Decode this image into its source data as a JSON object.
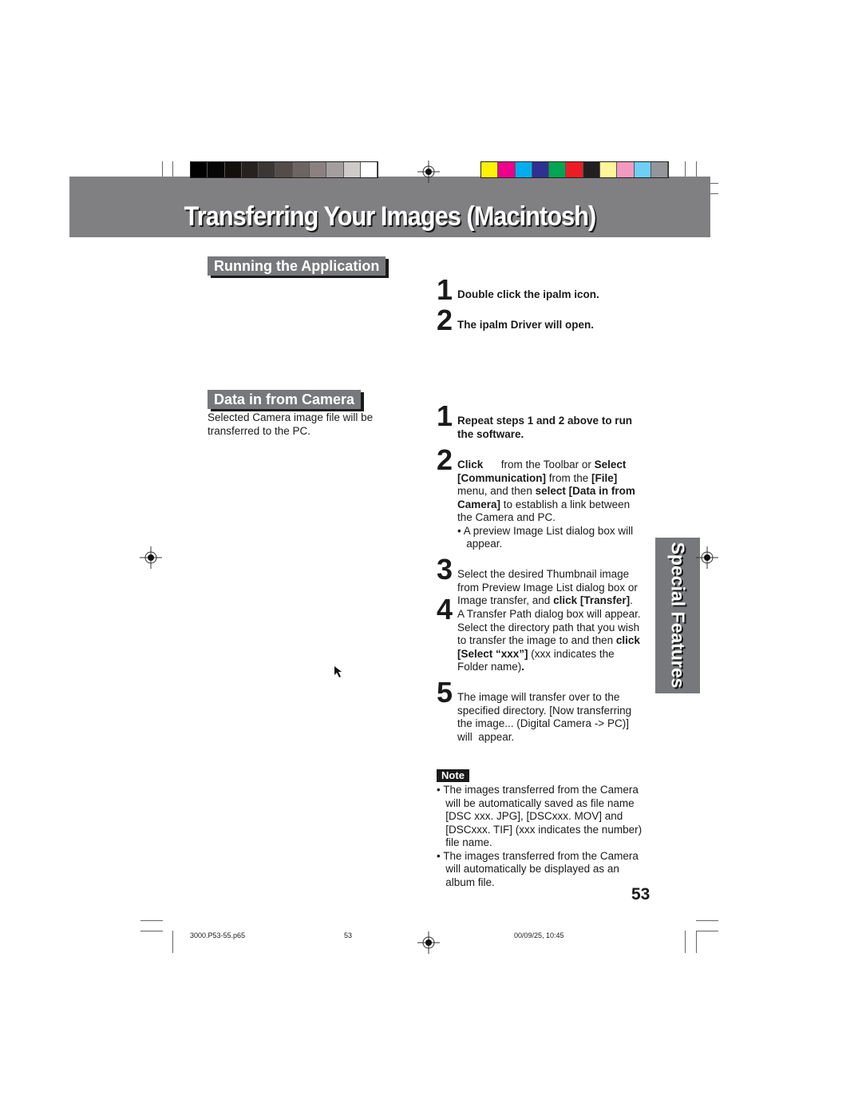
{
  "header": {
    "title": "Transferring Your Images (Macintosh)",
    "band_color": "#808082"
  },
  "color_bars": {
    "grayscale": [
      "#000000",
      "#060606",
      "#140e0c",
      "#272220",
      "#3b3735",
      "#544c49",
      "#6d6563",
      "#8a8180",
      "#a49f9e",
      "#cfcaca",
      "#ffffff"
    ],
    "process": [
      "#fff200",
      "#ec008c",
      "#00aeef",
      "#2e3192",
      "#00a651",
      "#ed1c24",
      "#231f20",
      "#fff799",
      "#f49ac1",
      "#6dcff6",
      "#939598"
    ]
  },
  "sections": [
    {
      "heading": "Running the Application"
    },
    {
      "heading": "Data in from Camera",
      "description": [
        "Selected Camera image file will be",
        "transferred to the PC."
      ]
    }
  ],
  "running_steps": [
    {
      "number": "1",
      "lines": [
        [
          {
            "t": "Double click the ipalm icon.",
            "b": true
          }
        ]
      ]
    },
    {
      "number": "2",
      "lines": [
        [
          {
            "t": "The ipalm Driver will open.",
            "b": true
          }
        ]
      ]
    }
  ],
  "data_steps": [
    {
      "number": "1",
      "lines": [
        [
          {
            "t": "Repeat steps 1 and 2 above to run",
            "b": true
          }
        ],
        [
          {
            "t": "the software.",
            "b": true
          }
        ]
      ]
    },
    {
      "number": "2",
      "lines": [
        [
          {
            "t": "Click",
            "b": true
          },
          {
            "t": "      from the Toolbar or ",
            "b": false
          },
          {
            "t": "Select",
            "b": true
          }
        ],
        [
          {
            "t": "[Communication]",
            "b": true
          },
          {
            "t": " from the ",
            "b": false
          },
          {
            "t": "[File]",
            "b": true
          }
        ],
        [
          {
            "t": "menu, and then ",
            "b": false
          },
          {
            "t": "select [Data in from",
            "b": true
          }
        ],
        [
          {
            "t": "Camera]",
            "b": true
          },
          {
            "t": " to establish a link between",
            "b": false
          }
        ],
        [
          {
            "t": "the Camera and PC.",
            "b": false
          }
        ],
        [
          {
            "t": "• A preview Image List dialog box will",
            "b": false
          }
        ],
        [
          {
            "t": "   appear.",
            "b": false
          }
        ]
      ]
    },
    {
      "number": "3",
      "lines": [
        [
          {
            "t": "Select the desired Thumbnail image",
            "b": false
          }
        ],
        [
          {
            "t": "from Preview Image List dialog box or",
            "b": false
          }
        ],
        [
          {
            "t": "Image transfer, and ",
            "b": false
          },
          {
            "t": "click [Transfer]",
            "b": true
          },
          {
            "t": ".",
            "b": false
          }
        ]
      ]
    },
    {
      "number": "4",
      "lines": [
        [
          {
            "t": "A Transfer Path dialog box will appear.",
            "b": false
          }
        ],
        [
          {
            "t": "Select the directory path that you wish",
            "b": false
          }
        ],
        [
          {
            "t": "to transfer the image to and then ",
            "b": false
          },
          {
            "t": "click",
            "b": true
          }
        ],
        [
          {
            "t": "[Select “xxx”]",
            "b": true
          },
          {
            "t": " (xxx indicates the",
            "b": false
          }
        ],
        [
          {
            "t": "Folder name)",
            "b": false
          },
          {
            "t": ".",
            "b": true
          }
        ]
      ]
    },
    {
      "number": "5",
      "lines": [
        [
          {
            "t": "The image will transfer over to the",
            "b": false
          }
        ],
        [
          {
            "t": "specified directory. [Now transferring",
            "b": false
          }
        ],
        [
          {
            "t": "the image... (Digital Camera -> PC)]",
            "b": false
          }
        ],
        [
          {
            "t": "will  appear.",
            "b": false
          }
        ]
      ]
    }
  ],
  "note": {
    "label": "Note",
    "lines": [
      [
        {
          "t": "• The images transferred from the Camera",
          "b": false
        }
      ],
      [
        {
          "t": "   will be automatically saved as file name",
          "b": false
        }
      ],
      [
        {
          "t": "   [DSC xxx. JPG], [DSCxxx. MOV] and",
          "b": false
        }
      ],
      [
        {
          "t": "   [DSCxxx. TIF] (xxx indicates the number)",
          "b": false
        }
      ],
      [
        {
          "t": "   file name.",
          "b": false
        }
      ],
      [
        {
          "t": "• The images transferred from the Camera",
          "b": false
        }
      ],
      [
        {
          "t": "   will automatically be displayed as an",
          "b": false
        }
      ],
      [
        {
          "t": "   album file.",
          "b": false
        }
      ]
    ]
  },
  "side_tab": {
    "label": "Special  Features"
  },
  "page_number": "53",
  "footer": {
    "file": "3000.P53-55.p65",
    "page": "53",
    "timestamp": "00/09/25, 10:45"
  }
}
